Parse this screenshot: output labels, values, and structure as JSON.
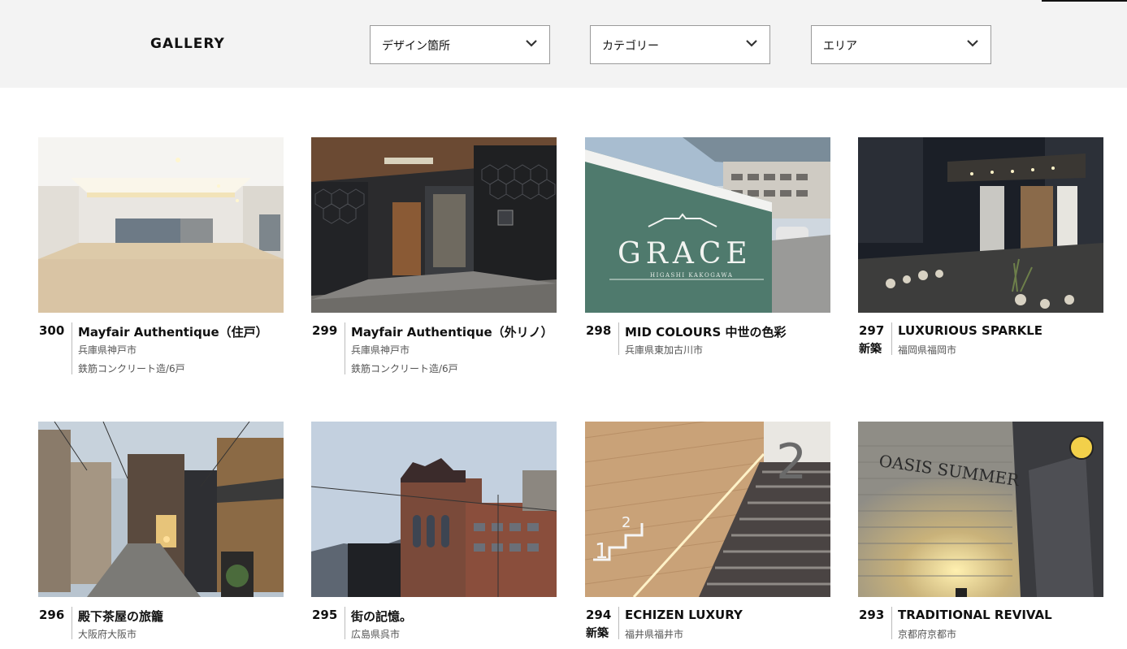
{
  "header": {
    "brand": "GALLERY",
    "filters": [
      {
        "label": "デザイン箇所"
      },
      {
        "label": "カテゴリー"
      },
      {
        "label": "エリア"
      }
    ]
  },
  "cards": [
    {
      "number": "300",
      "title": "Mayfair Authentique（住戸）",
      "location": "兵庫県神戸市",
      "spec": "鉄筋コンクリート造/6戸",
      "badge": ""
    },
    {
      "number": "299",
      "title": "Mayfair Authentique（外リノ）",
      "location": "兵庫県神戸市",
      "spec": "鉄筋コンクリート造/6戸",
      "badge": ""
    },
    {
      "number": "298",
      "title": "MID COLOURS 中世の色彩",
      "location": "兵庫県東加古川市",
      "spec": "",
      "badge": "",
      "sign_text": "GRACE",
      "sign_sub": "HIGASHI KAKOGAWA"
    },
    {
      "number": "297",
      "title": "LUXURIOUS SPARKLE",
      "location": "福岡県福岡市",
      "spec": "",
      "badge": "新築"
    },
    {
      "number": "296",
      "title": "殿下茶屋の旅籠",
      "location": "大阪府大阪市",
      "spec": "",
      "badge": ""
    },
    {
      "number": "295",
      "title": "街の記憶。",
      "location": "広島県呉市",
      "spec": "",
      "badge": ""
    },
    {
      "number": "294",
      "title": "ECHIZEN LUXURY",
      "location": "福井県福井市",
      "spec": "",
      "badge": "新築"
    },
    {
      "number": "293",
      "title": "TRADITIONAL REVIVAL",
      "location": "京都府京都市",
      "spec": "",
      "badge": "",
      "sign_text": "OASIS SUMMER"
    }
  ],
  "colors": {
    "header_bg": "#f3f3f3",
    "text": "#111111",
    "subtext": "#555555"
  }
}
